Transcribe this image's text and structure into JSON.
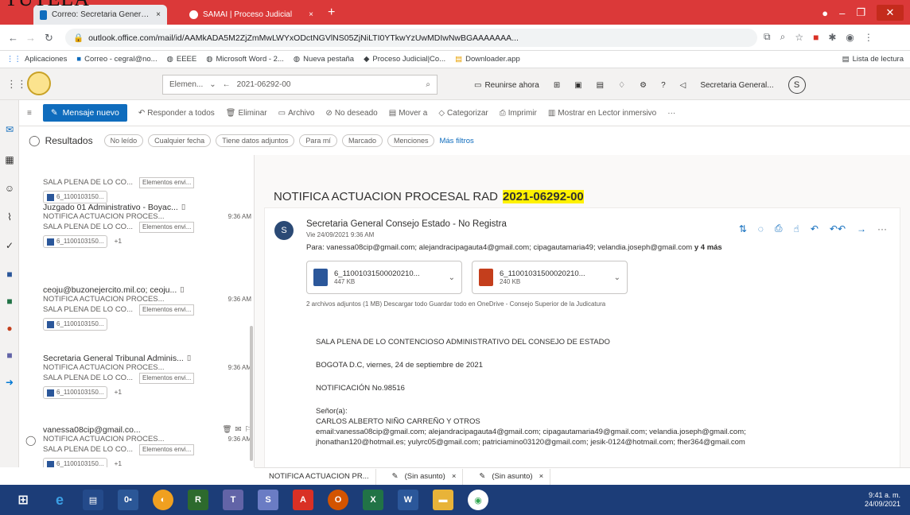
{
  "overlay_text": "TUTELA",
  "browser": {
    "tabs": [
      {
        "label": "Correo: Secretaria General Consejo...",
        "close": "×"
      },
      {
        "label": "SAMAI | Proceso Judicial",
        "close": "×"
      }
    ],
    "new_tab": "+",
    "url": "outlook.office.com/mail/id/AAMkADA5M2ZjZmMwLWYxODctNGVlNS05ZjNiLTI0YTkwYzUwMDIwNwBGAAAAAAA...",
    "bookmarks": [
      "Aplicaciones",
      "Correo - cegral@no...",
      "EEEE",
      "Microsoft Word - 2...",
      "Nueva pestaña",
      "Proceso Judicial|Co...",
      "Downloader.app"
    ],
    "reading_list": "Lista de lectura"
  },
  "owa": {
    "search_scope": "Elemen...",
    "search_value": "2021-06292-00",
    "meet_now": "Reunirse ahora",
    "account_name": "Secretaria General...",
    "account_initial": "S"
  },
  "commands": {
    "new_message": "Mensaje nuevo",
    "reply_all": "Responder a todos",
    "delete": "Eliminar",
    "archive": "Archivo",
    "junk": "No deseado",
    "move": "Mover a",
    "categorize": "Categorizar",
    "print": "Imprimir",
    "immersive": "Mostrar en Lector inmersivo",
    "more": "···"
  },
  "filters": {
    "results": "Resultados",
    "chips": [
      "No leído",
      "Cualquier fecha",
      "Tiene datos adjuntos",
      "Para mí",
      "Marcado",
      "Menciones"
    ],
    "more": "Más filtros"
  },
  "messages": [
    {
      "sender": "",
      "subject": "SALA PLENA DE LO CO...",
      "tag": "Elementos envi...",
      "att": "6_1100103150...",
      "count": "",
      "time": ""
    },
    {
      "sender": "Juzgado 01 Administrativo - Boyac...",
      "subject": "NOTIFICA ACTUACION PROCES...",
      "preview": "SALA PLENA DE LO CO...",
      "tag": "Elementos envi...",
      "att": "6_1100103150...",
      "count": "+1",
      "time": "9:36 AM"
    },
    {
      "sender": "ceoju@buzonejercito.mil.co; ceoju...",
      "subject": "NOTIFICA ACTUACION PROCES...",
      "preview": "SALA PLENA DE LO CO...",
      "tag": "Elementos envi...",
      "att": "6_1100103150...",
      "count": "",
      "time": "9:36 AM"
    },
    {
      "sender": "Secretaria General Tribunal Adminis...",
      "subject": "NOTIFICA ACTUACION PROCES...",
      "preview": "SALA PLENA DE LO CO...",
      "tag": "Elementos envi...",
      "att": "6_1100103150...",
      "count": "+1",
      "time": "9:36 AM"
    },
    {
      "sender": "vanessa08cip@gmail.co...",
      "subject": "NOTIFICA ACTUACION PROCES...",
      "preview": "SALA PLENA DE LO CO...",
      "tag": "Elementos envi...",
      "att": "6_1100103150...",
      "count": "+1",
      "time": "9:36 AM"
    }
  ],
  "email": {
    "subject_prefix": "NOTIFICA ACTUACION PROCESAL RAD",
    "subject_rad": "2021-06292-00",
    "sender": "Secretaria General Consejo Estado - No Registra",
    "sender_initial": "S",
    "sent": "Vie 24/09/2021 9:36 AM",
    "to_label": "Para:",
    "to": "vanessa08cip@gmail.com; alejandracipagauta4@gmail.com; cipagautamaria49; velandia.joseph@gmail.com",
    "to_more": "y 4 más",
    "attachments": [
      {
        "name": "6_11001031500020210...",
        "size": "447 KB",
        "color": "#2b579a"
      },
      {
        "name": "6_11001031500020210...",
        "size": "240 KB",
        "color": "#c43e1c"
      }
    ],
    "att_info": "2 archivos adjuntos (1 MB)   Descargar todo   Guardar todo en OneDrive - Consejo Superior de la Judicatura",
    "body": [
      "SALA PLENA DE LO CONTENCIOSO ADMINISTRATIVO DEL CONSEJO DE ESTADO",
      "BOGOTA D.C, viernes, 24 de septiembre de 2021",
      "NOTIFICACIÓN No.98516"
    ],
    "salutation": "Señor(a):",
    "recipient": "CARLOS ALBERTO NIÑO CARREÑO Y OTROS",
    "emails_1": "email:vanessa08cip@gmail.com; alejandracipagauta4@gmail.com; cipagautamaria49@gmail.com; velandia.joseph@gmail.com;",
    "emails_2": "jhonathan120@hotmail.es; yulyrc05@gmail.com; patriciamino03120@gmail.com; jesik-0124@hotmail.com; fher364@gmail.com"
  },
  "drafts": [
    {
      "label": "NOTIFICA ACTUACION PR...",
      "close": ""
    },
    {
      "label": "(Sin asunto)",
      "close": "×"
    },
    {
      "label": "(Sin asunto)",
      "close": "×"
    }
  ],
  "clock": {
    "time": "9:41 a. m.",
    "date": "24/09/2021"
  }
}
